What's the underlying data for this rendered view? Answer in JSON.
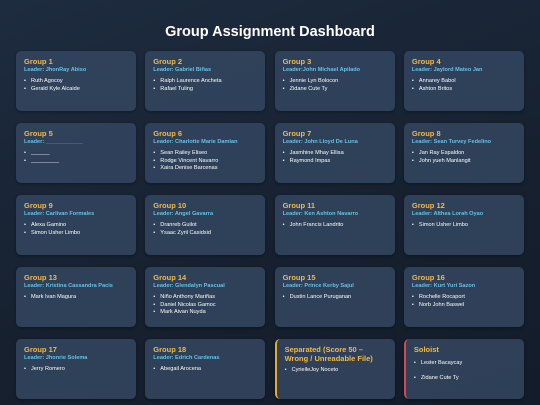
{
  "title": "Group Assignment Dashboard",
  "groups": [
    {
      "name": "Group 1",
      "leader": "Leader: JhonRay Abiso",
      "members": [
        "Ruth Agocoy",
        "Gerald Kyle Alcaide"
      ]
    },
    {
      "name": "Group 2",
      "leader": "Leader: Gabriel Biñas",
      "members": [
        "Ralph Laurence Ancheta",
        "Rafael Tuling"
      ]
    },
    {
      "name": "Group 3",
      "leader": "Leader:John Michael Apilado",
      "members": [
        "Jennie Lyn Bolocon",
        "Zidane Cute Ty"
      ]
    },
    {
      "name": "Group 4",
      "leader": "Leader: Jaylord Mateo Jan",
      "members": [
        "Annarey Babol",
        "Ashton Britos"
      ]
    },
    {
      "name": "Group 5",
      "leader": "Leader: ____________",
      "members": [
        "______",
        "_________"
      ]
    },
    {
      "name": "Group 6",
      "leader": "Leader: Charlotte Marie Damian",
      "members": [
        "Sean Railey Eliseo",
        "Rodge Vincent Navarro",
        "Xaira Denise Barcenas"
      ]
    },
    {
      "name": "Group 7",
      "leader": "Leader: John Lloyd De Luna",
      "members": [
        "Jasmhine Mhay Ellisa",
        "Raymond Impas"
      ]
    },
    {
      "name": "Group 8",
      "leader": "Leader: Sean Turvey Fedelino",
      "members": [
        "Jan Ray Espaldon",
        "John yueh Manlangit"
      ]
    },
    {
      "name": "Group 9",
      "leader": "Leader: Carlivan Formales",
      "members": [
        "Alexa Gamino",
        "Simon Usher Limbo"
      ]
    },
    {
      "name": "Group 10",
      "leader": "Leader: Angel Gavarra",
      "members": [
        "Dranreb Guilot",
        "Ysaac Zyril Casidsid"
      ]
    },
    {
      "name": "Group 11",
      "leader": "Leader: Ken Ashton Navarro",
      "members": [
        "John Francis Landrito"
      ]
    },
    {
      "name": "Group 12",
      "leader": "Leader: Althea Lorah Oyao",
      "members": [
        "Simon Usher Limbo"
      ]
    },
    {
      "name": "Group 13",
      "leader": "Leader: Kristina Cassandra Pacis",
      "members": [
        "Mark Ivan Magura"
      ]
    },
    {
      "name": "Group 14",
      "leader": "Leader: Glendalyn Pascual",
      "members": [
        "Niño Anthony Mariñas",
        "Daniel Nicolas Gamoc",
        "Mark Aivan Nuyda"
      ]
    },
    {
      "name": "Group 15",
      "leader": "Leader: Prince Kerby Sajul",
      "members": [
        "Dustin Lance Puruganan"
      ]
    },
    {
      "name": "Group 16",
      "leader": "Leader: Kurt Yuri Sazon",
      "members": [
        "Rochelle Rocaport",
        "Norb John Baswel"
      ]
    },
    {
      "name": "Group 17",
      "leader": "Leader: Jhonrie Solema",
      "members": [
        "Jerry Romero"
      ]
    },
    {
      "name": "Group 18",
      "leader": "Leader: Edrich Cardenas",
      "members": [
        "Abegail Arocena"
      ]
    }
  ],
  "separated": {
    "title": "Separated (Score 50 – Wrong / Unreadable File)",
    "members": [
      "CyrielleJoy Noceto"
    ]
  },
  "soloist": {
    "title": "Soloist",
    "members": [
      "Lester Bacaycay",
      "Zidane Cute Ty"
    ]
  },
  "bullet": "•",
  "colors": {
    "group_title": "#f4b942",
    "leader": "#62c2e6",
    "separated_border": "#e2ad2e",
    "soloist_border": "#d24a55"
  }
}
